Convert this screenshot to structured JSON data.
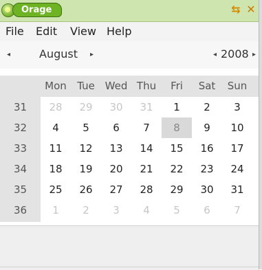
{
  "titlebar": {
    "title": "Orage",
    "app_icon": "orage-icon",
    "restore_glyph": "⇆",
    "close_glyph": "✕"
  },
  "menu": [
    "File",
    "Edit",
    "View",
    "Help"
  ],
  "nav": {
    "month": "August",
    "year": "2008",
    "prev_glyph": "◂",
    "next_glyph": "▸"
  },
  "calendar": {
    "day_headers": [
      "Mon",
      "Tue",
      "Wed",
      "Thu",
      "Fri",
      "Sat",
      "Sun"
    ],
    "weeks": [
      {
        "number": "31",
        "days": [
          {
            "d": "28",
            "other": true
          },
          {
            "d": "29",
            "other": true
          },
          {
            "d": "30",
            "other": true
          },
          {
            "d": "31",
            "other": true
          },
          {
            "d": "1"
          },
          {
            "d": "2"
          },
          {
            "d": "3"
          }
        ]
      },
      {
        "number": "32",
        "days": [
          {
            "d": "4"
          },
          {
            "d": "5"
          },
          {
            "d": "6"
          },
          {
            "d": "7"
          },
          {
            "d": "8",
            "today": true
          },
          {
            "d": "9"
          },
          {
            "d": "10"
          }
        ]
      },
      {
        "number": "33",
        "days": [
          {
            "d": "11"
          },
          {
            "d": "12"
          },
          {
            "d": "13"
          },
          {
            "d": "14"
          },
          {
            "d": "15"
          },
          {
            "d": "16"
          },
          {
            "d": "17"
          }
        ]
      },
      {
        "number": "34",
        "days": [
          {
            "d": "18"
          },
          {
            "d": "19"
          },
          {
            "d": "20"
          },
          {
            "d": "21"
          },
          {
            "d": "22"
          },
          {
            "d": "23"
          },
          {
            "d": "24"
          }
        ]
      },
      {
        "number": "35",
        "days": [
          {
            "d": "25"
          },
          {
            "d": "26"
          },
          {
            "d": "27"
          },
          {
            "d": "28"
          },
          {
            "d": "29"
          },
          {
            "d": "30"
          },
          {
            "d": "31"
          }
        ]
      },
      {
        "number": "36",
        "days": [
          {
            "d": "1",
            "other": true
          },
          {
            "d": "2",
            "other": true
          },
          {
            "d": "3",
            "other": true
          },
          {
            "d": "4",
            "other": true
          },
          {
            "d": "5",
            "other": true
          },
          {
            "d": "6",
            "other": true
          },
          {
            "d": "7",
            "other": true
          }
        ]
      }
    ]
  },
  "colors": {
    "title_green": "#6db324",
    "titlebar_bg": "#cfe5b0",
    "today_bg": "#d9d9d9",
    "header_bg": "#e3e3e3"
  }
}
